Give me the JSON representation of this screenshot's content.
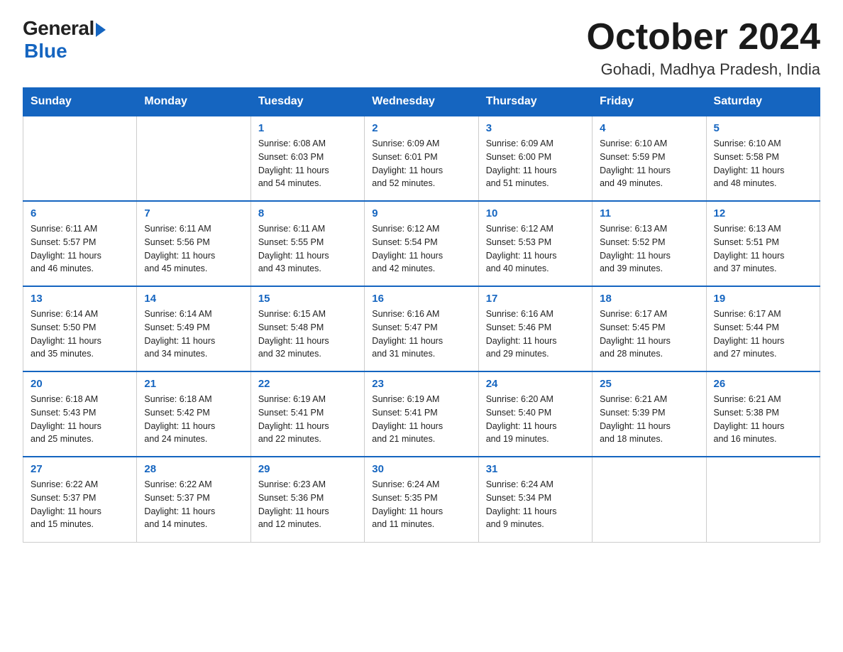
{
  "logo": {
    "general": "General",
    "blue": "Blue"
  },
  "header": {
    "month": "October 2024",
    "location": "Gohadi, Madhya Pradesh, India"
  },
  "days_of_week": [
    "Sunday",
    "Monday",
    "Tuesday",
    "Wednesday",
    "Thursday",
    "Friday",
    "Saturday"
  ],
  "weeks": [
    [
      {
        "day": "",
        "info": ""
      },
      {
        "day": "",
        "info": ""
      },
      {
        "day": "1",
        "info": "Sunrise: 6:08 AM\nSunset: 6:03 PM\nDaylight: 11 hours\nand 54 minutes."
      },
      {
        "day": "2",
        "info": "Sunrise: 6:09 AM\nSunset: 6:01 PM\nDaylight: 11 hours\nand 52 minutes."
      },
      {
        "day": "3",
        "info": "Sunrise: 6:09 AM\nSunset: 6:00 PM\nDaylight: 11 hours\nand 51 minutes."
      },
      {
        "day": "4",
        "info": "Sunrise: 6:10 AM\nSunset: 5:59 PM\nDaylight: 11 hours\nand 49 minutes."
      },
      {
        "day": "5",
        "info": "Sunrise: 6:10 AM\nSunset: 5:58 PM\nDaylight: 11 hours\nand 48 minutes."
      }
    ],
    [
      {
        "day": "6",
        "info": "Sunrise: 6:11 AM\nSunset: 5:57 PM\nDaylight: 11 hours\nand 46 minutes."
      },
      {
        "day": "7",
        "info": "Sunrise: 6:11 AM\nSunset: 5:56 PM\nDaylight: 11 hours\nand 45 minutes."
      },
      {
        "day": "8",
        "info": "Sunrise: 6:11 AM\nSunset: 5:55 PM\nDaylight: 11 hours\nand 43 minutes."
      },
      {
        "day": "9",
        "info": "Sunrise: 6:12 AM\nSunset: 5:54 PM\nDaylight: 11 hours\nand 42 minutes."
      },
      {
        "day": "10",
        "info": "Sunrise: 6:12 AM\nSunset: 5:53 PM\nDaylight: 11 hours\nand 40 minutes."
      },
      {
        "day": "11",
        "info": "Sunrise: 6:13 AM\nSunset: 5:52 PM\nDaylight: 11 hours\nand 39 minutes."
      },
      {
        "day": "12",
        "info": "Sunrise: 6:13 AM\nSunset: 5:51 PM\nDaylight: 11 hours\nand 37 minutes."
      }
    ],
    [
      {
        "day": "13",
        "info": "Sunrise: 6:14 AM\nSunset: 5:50 PM\nDaylight: 11 hours\nand 35 minutes."
      },
      {
        "day": "14",
        "info": "Sunrise: 6:14 AM\nSunset: 5:49 PM\nDaylight: 11 hours\nand 34 minutes."
      },
      {
        "day": "15",
        "info": "Sunrise: 6:15 AM\nSunset: 5:48 PM\nDaylight: 11 hours\nand 32 minutes."
      },
      {
        "day": "16",
        "info": "Sunrise: 6:16 AM\nSunset: 5:47 PM\nDaylight: 11 hours\nand 31 minutes."
      },
      {
        "day": "17",
        "info": "Sunrise: 6:16 AM\nSunset: 5:46 PM\nDaylight: 11 hours\nand 29 minutes."
      },
      {
        "day": "18",
        "info": "Sunrise: 6:17 AM\nSunset: 5:45 PM\nDaylight: 11 hours\nand 28 minutes."
      },
      {
        "day": "19",
        "info": "Sunrise: 6:17 AM\nSunset: 5:44 PM\nDaylight: 11 hours\nand 27 minutes."
      }
    ],
    [
      {
        "day": "20",
        "info": "Sunrise: 6:18 AM\nSunset: 5:43 PM\nDaylight: 11 hours\nand 25 minutes."
      },
      {
        "day": "21",
        "info": "Sunrise: 6:18 AM\nSunset: 5:42 PM\nDaylight: 11 hours\nand 24 minutes."
      },
      {
        "day": "22",
        "info": "Sunrise: 6:19 AM\nSunset: 5:41 PM\nDaylight: 11 hours\nand 22 minutes."
      },
      {
        "day": "23",
        "info": "Sunrise: 6:19 AM\nSunset: 5:41 PM\nDaylight: 11 hours\nand 21 minutes."
      },
      {
        "day": "24",
        "info": "Sunrise: 6:20 AM\nSunset: 5:40 PM\nDaylight: 11 hours\nand 19 minutes."
      },
      {
        "day": "25",
        "info": "Sunrise: 6:21 AM\nSunset: 5:39 PM\nDaylight: 11 hours\nand 18 minutes."
      },
      {
        "day": "26",
        "info": "Sunrise: 6:21 AM\nSunset: 5:38 PM\nDaylight: 11 hours\nand 16 minutes."
      }
    ],
    [
      {
        "day": "27",
        "info": "Sunrise: 6:22 AM\nSunset: 5:37 PM\nDaylight: 11 hours\nand 15 minutes."
      },
      {
        "day": "28",
        "info": "Sunrise: 6:22 AM\nSunset: 5:37 PM\nDaylight: 11 hours\nand 14 minutes."
      },
      {
        "day": "29",
        "info": "Sunrise: 6:23 AM\nSunset: 5:36 PM\nDaylight: 11 hours\nand 12 minutes."
      },
      {
        "day": "30",
        "info": "Sunrise: 6:24 AM\nSunset: 5:35 PM\nDaylight: 11 hours\nand 11 minutes."
      },
      {
        "day": "31",
        "info": "Sunrise: 6:24 AM\nSunset: 5:34 PM\nDaylight: 11 hours\nand 9 minutes."
      },
      {
        "day": "",
        "info": ""
      },
      {
        "day": "",
        "info": ""
      }
    ]
  ]
}
